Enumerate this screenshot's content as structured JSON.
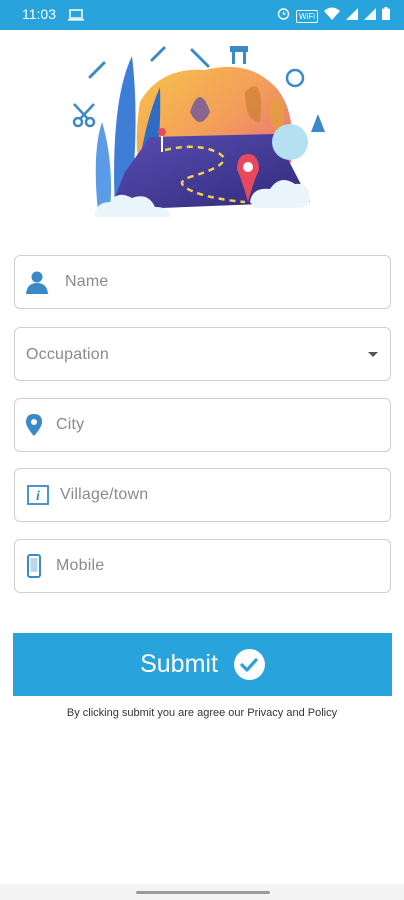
{
  "status_bar": {
    "time": "11:03",
    "wifi_label": "WiFi",
    "icons": [
      "laptop-icon",
      "alarm-icon",
      "wifi-icon",
      "signal-icon",
      "battery-icon"
    ]
  },
  "hero": {
    "image": "travel-road-illustration"
  },
  "form": {
    "name_placeholder": "Name",
    "occupation_placeholder": "Occupation",
    "city_placeholder": "City",
    "village_placeholder": "Village/town",
    "mobile_placeholder": "Mobile"
  },
  "submit": {
    "label": "Submit"
  },
  "terms": "By clicking submit you are agree our Privacy and Policy",
  "colors": {
    "accent": "#29a3dc",
    "field_border": "#cfcfcf",
    "placeholder": "#8a8a8a",
    "icon_blue": "#3a89c9"
  }
}
